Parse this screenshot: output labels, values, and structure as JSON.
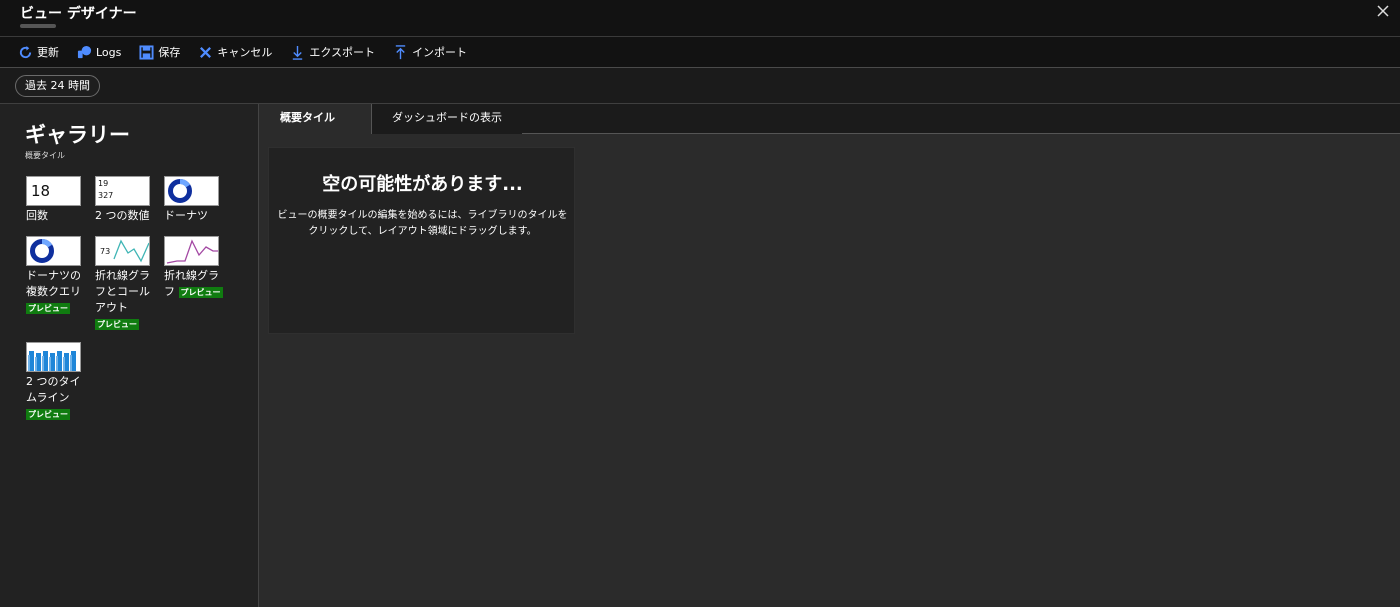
{
  "header": {
    "title": "ビュー デザイナー"
  },
  "toolbar": {
    "items": [
      {
        "label": "更新",
        "icon": "refresh-icon"
      },
      {
        "label": "Logs",
        "icon": "logs-icon"
      },
      {
        "label": "保存",
        "icon": "save-icon"
      },
      {
        "label": "キャンセル",
        "icon": "cancel-icon"
      },
      {
        "label": "エクスポート",
        "icon": "export-icon"
      },
      {
        "label": "インポート",
        "icon": "import-icon"
      }
    ]
  },
  "time_range": "過去 24 時間",
  "gallery": {
    "title": "ギャラリー",
    "subtitle": "概要タイル",
    "tiles": [
      {
        "label": "回数",
        "thumb_number": "18",
        "preview": ""
      },
      {
        "label": "2 つの数値",
        "thumb_numbers": [
          "19",
          "327"
        ],
        "preview": ""
      },
      {
        "label": "ドーナツ",
        "preview": ""
      },
      {
        "label": "ドーナツの複数クエリ",
        "preview": "プレビュー"
      },
      {
        "label": "折れ線グラフとコールアウト",
        "thumb_number": "73",
        "preview": "プレビュー"
      },
      {
        "label": "折れ線グラフ",
        "preview": "プレビュー"
      },
      {
        "label": "2 つのタイムライン",
        "preview": "プレビュー"
      }
    ]
  },
  "tabs": [
    {
      "label": "概要タイル",
      "active": true
    },
    {
      "label": "ダッシュボードの表示",
      "active": false
    }
  ],
  "empty_state": {
    "title": "空の可能性があります...",
    "description": "ビューの概要タイルの編集を始めるには、ライブラリのタイルをクリックして、レイアウト領域にドラッグします。"
  },
  "colors": {
    "accent_blue": "#4f8cff",
    "preview_badge": "#107c10",
    "donut": "#0f2f9e",
    "line_teal": "#3fb5b5",
    "line_purple": "#a348a3",
    "timeline_blue": "#1f86d8"
  }
}
